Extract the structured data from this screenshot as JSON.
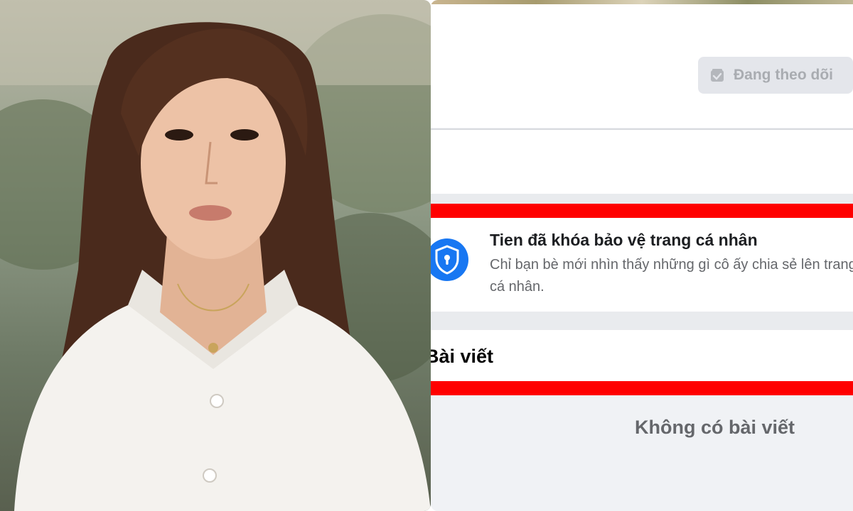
{
  "profile": {
    "follow_button_label": "Đang theo dõi",
    "follow_icon": "following-check-icon"
  },
  "locked_notice": {
    "icon": "shield-lock-icon",
    "title": "Tien đã khóa bảo vệ trang cá nhân",
    "description": "Chỉ bạn bè mới nhìn thấy những gì cô ấy chia sẻ lên trang cá nhân."
  },
  "posts": {
    "section_title": "Bài viết",
    "empty_message": "Không có bài viết"
  },
  "colors": {
    "highlight_red": "#ff0000",
    "facebook_blue": "#1877f2",
    "secondary_text": "#65676b"
  }
}
